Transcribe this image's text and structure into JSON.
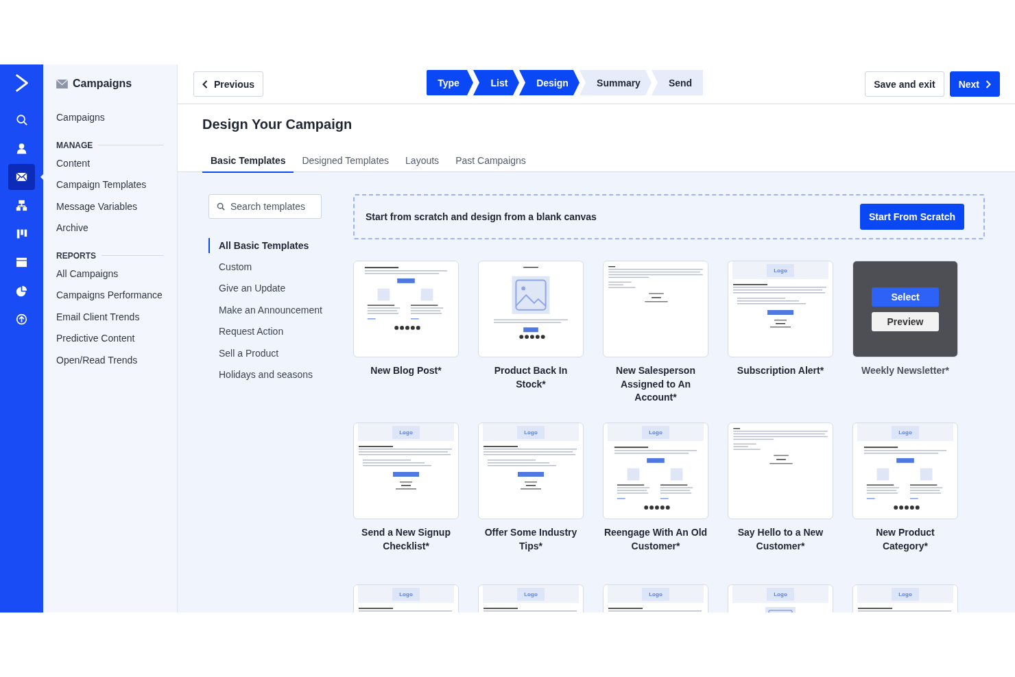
{
  "rail": [
    {
      "selected": false
    },
    {
      "selected": false
    },
    {
      "selected": true
    },
    {
      "selected": false
    },
    {
      "selected": false
    },
    {
      "selected": false
    },
    {
      "selected": false
    },
    {
      "selected": false
    }
  ],
  "sidebar": {
    "title": "Campaigns",
    "top_items": [
      "Campaigns"
    ],
    "sections": [
      {
        "heading": "MANAGE",
        "items": [
          "Content",
          "Campaign Templates",
          "Message Variables",
          "Archive"
        ]
      },
      {
        "heading": "REPORTS",
        "items": [
          "All Campaigns",
          "Campaigns Performance",
          "Email Client Trends",
          "Predictive Content",
          "Open/Read Trends"
        ]
      }
    ]
  },
  "topbar": {
    "previous": "Previous",
    "save": "Save and exit",
    "next": "Next",
    "steps": [
      {
        "label": "Type",
        "reached": true
      },
      {
        "label": "List",
        "reached": true
      },
      {
        "label": "Design",
        "reached": true
      },
      {
        "label": "Summary",
        "reached": false
      },
      {
        "label": "Send",
        "reached": false
      }
    ]
  },
  "page_title": "Design Your Campaign",
  "tabs": [
    {
      "label": "Basic Templates",
      "selected": true
    },
    {
      "label": "Designed Templates",
      "selected": false
    },
    {
      "label": "Layouts",
      "selected": false
    },
    {
      "label": "Past Campaigns",
      "selected": false
    }
  ],
  "search": {
    "placeholder": "Search templates"
  },
  "filters": [
    {
      "label": "All Basic Templates",
      "selected": true
    },
    {
      "label": "Custom",
      "selected": false
    },
    {
      "label": "Give an Update",
      "selected": false
    },
    {
      "label": "Make an Announcement",
      "selected": false
    },
    {
      "label": "Request Action",
      "selected": false
    },
    {
      "label": "Sell a Product",
      "selected": false
    },
    {
      "label": "Holidays and seasons",
      "selected": false
    }
  ],
  "scratch": {
    "text": "Start from scratch and design from a blank canvas",
    "button": "Start From Scratch"
  },
  "templates": [
    {
      "title": "New Blog Post*",
      "kind": "columns"
    },
    {
      "title": "Product Back In Stock*",
      "kind": "hero"
    },
    {
      "title": "New Salesperson Assigned to An Account*",
      "kind": "text"
    },
    {
      "title": "Subscription Alert*",
      "kind": "list",
      "logo": "Logo"
    },
    {
      "title": "Weekly Newsletter*",
      "kind": "list",
      "actions": [
        "Select",
        "Preview"
      ]
    },
    {
      "title": "Send a New Signup Checklist*",
      "kind": "list",
      "logo": "Logo"
    },
    {
      "title": "Offer Some Industry Tips*",
      "kind": "list",
      "logo": "Logo"
    },
    {
      "title": "Reengage With An Old Customer*",
      "kind": "columns",
      "logo": "Logo"
    },
    {
      "title": "Say Hello to a New Customer*",
      "kind": "text"
    },
    {
      "title": "New Product Category*",
      "kind": "columns",
      "logo": "Logo"
    },
    {
      "kind": "list",
      "logo": "Logo"
    },
    {
      "kind": "list",
      "logo": "Logo"
    },
    {
      "kind": "list",
      "logo": "Logo"
    },
    {
      "kind": "image",
      "logo": "Logo"
    },
    {
      "kind": "list",
      "logo": "Logo"
    }
  ]
}
